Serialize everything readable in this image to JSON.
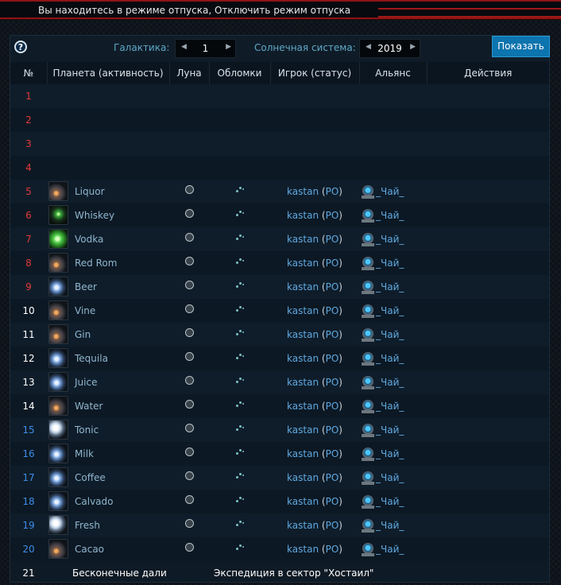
{
  "vacation": {
    "text": "Вы находитесь в режиме отпуска, Отключить режим отпуска"
  },
  "controls": {
    "help": "?",
    "galaxy_label": "Галактика:",
    "galaxy_value": "1",
    "system_label": "Солнечная система:",
    "system_value": "2019",
    "show_button": "Показать"
  },
  "table": {
    "headers": [
      "№",
      "Планета (активность)",
      "Луна",
      "Обломки",
      "Игрок (статус)",
      "Альянс",
      "Действия"
    ],
    "empty_rows": [
      "1",
      "2",
      "3",
      "4"
    ],
    "rows": [
      {
        "num": "5",
        "planet": "Liquor",
        "player": "kastan",
        "status": "PO",
        "alliance": "_Чай_",
        "num_color": "#e03a3a",
        "thumb": "rocky"
      },
      {
        "num": "6",
        "planet": "Whiskey",
        "player": "kastan",
        "status": "PO",
        "alliance": "_Чай_",
        "num_color": "#e03a3a",
        "thumb": "green-dark"
      },
      {
        "num": "7",
        "planet": "Vodka",
        "player": "kastan",
        "status": "PO",
        "alliance": "_Чай_",
        "num_color": "#e03a3a",
        "thumb": "green"
      },
      {
        "num": "8",
        "planet": "Red Rom",
        "player": "kastan",
        "status": "PO",
        "alliance": "_Чай_",
        "num_color": "#e03a3a",
        "thumb": "rocky"
      },
      {
        "num": "9",
        "planet": "Beer",
        "player": "kastan",
        "status": "PO",
        "alliance": "_Чай_",
        "num_color": "#e03a3a",
        "thumb": "icy"
      },
      {
        "num": "10",
        "planet": "Vine",
        "player": "kastan",
        "status": "PO",
        "alliance": "_Чай_",
        "num_color": "#ffffff",
        "thumb": "rocky"
      },
      {
        "num": "11",
        "planet": "Gin",
        "player": "kastan",
        "status": "PO",
        "alliance": "_Чай_",
        "num_color": "#ffffff",
        "thumb": "rocky"
      },
      {
        "num": "12",
        "planet": "Tequila",
        "player": "kastan",
        "status": "PO",
        "alliance": "_Чай_",
        "num_color": "#ffffff",
        "thumb": "icy"
      },
      {
        "num": "13",
        "planet": "Juice",
        "player": "kastan",
        "status": "PO",
        "alliance": "_Чай_",
        "num_color": "#ffffff",
        "thumb": "icy"
      },
      {
        "num": "14",
        "planet": "Water",
        "player": "kastan",
        "status": "PO",
        "alliance": "_Чай_",
        "num_color": "#ffffff",
        "thumb": "rocky"
      },
      {
        "num": "15",
        "planet": "Tonic",
        "player": "kastan",
        "status": "PO",
        "alliance": "_Чай_",
        "num_color": "#3b8eea",
        "thumb": "bright"
      },
      {
        "num": "16",
        "planet": "Milk",
        "player": "kastan",
        "status": "PO",
        "alliance": "_Чай_",
        "num_color": "#3b8eea",
        "thumb": "icy"
      },
      {
        "num": "17",
        "planet": "Coffee",
        "player": "kastan",
        "status": "PO",
        "alliance": "_Чай_",
        "num_color": "#3b8eea",
        "thumb": "icy"
      },
      {
        "num": "18",
        "planet": "Calvado",
        "player": "kastan",
        "status": "PO",
        "alliance": "_Чай_",
        "num_color": "#3b8eea",
        "thumb": "icy"
      },
      {
        "num": "19",
        "planet": "Fresh",
        "player": "kastan",
        "status": "PO",
        "alliance": "_Чай_",
        "num_color": "#3b8eea",
        "thumb": "bright"
      },
      {
        "num": "20",
        "planet": "Cacao",
        "player": "kastan",
        "status": "PO",
        "alliance": "_Чай_",
        "num_color": "#3b8eea",
        "thumb": "rocky"
      }
    ],
    "last_row": {
      "num": "21",
      "deep_space": "Бесконечные дали",
      "expedition": "Экспедиция в сектор \"Хостаил\""
    }
  },
  "colors": {
    "accent": "#0c74ae",
    "player": "#5fa8e0",
    "planet": "#8fb6cf",
    "danger": "#e03a3a"
  }
}
